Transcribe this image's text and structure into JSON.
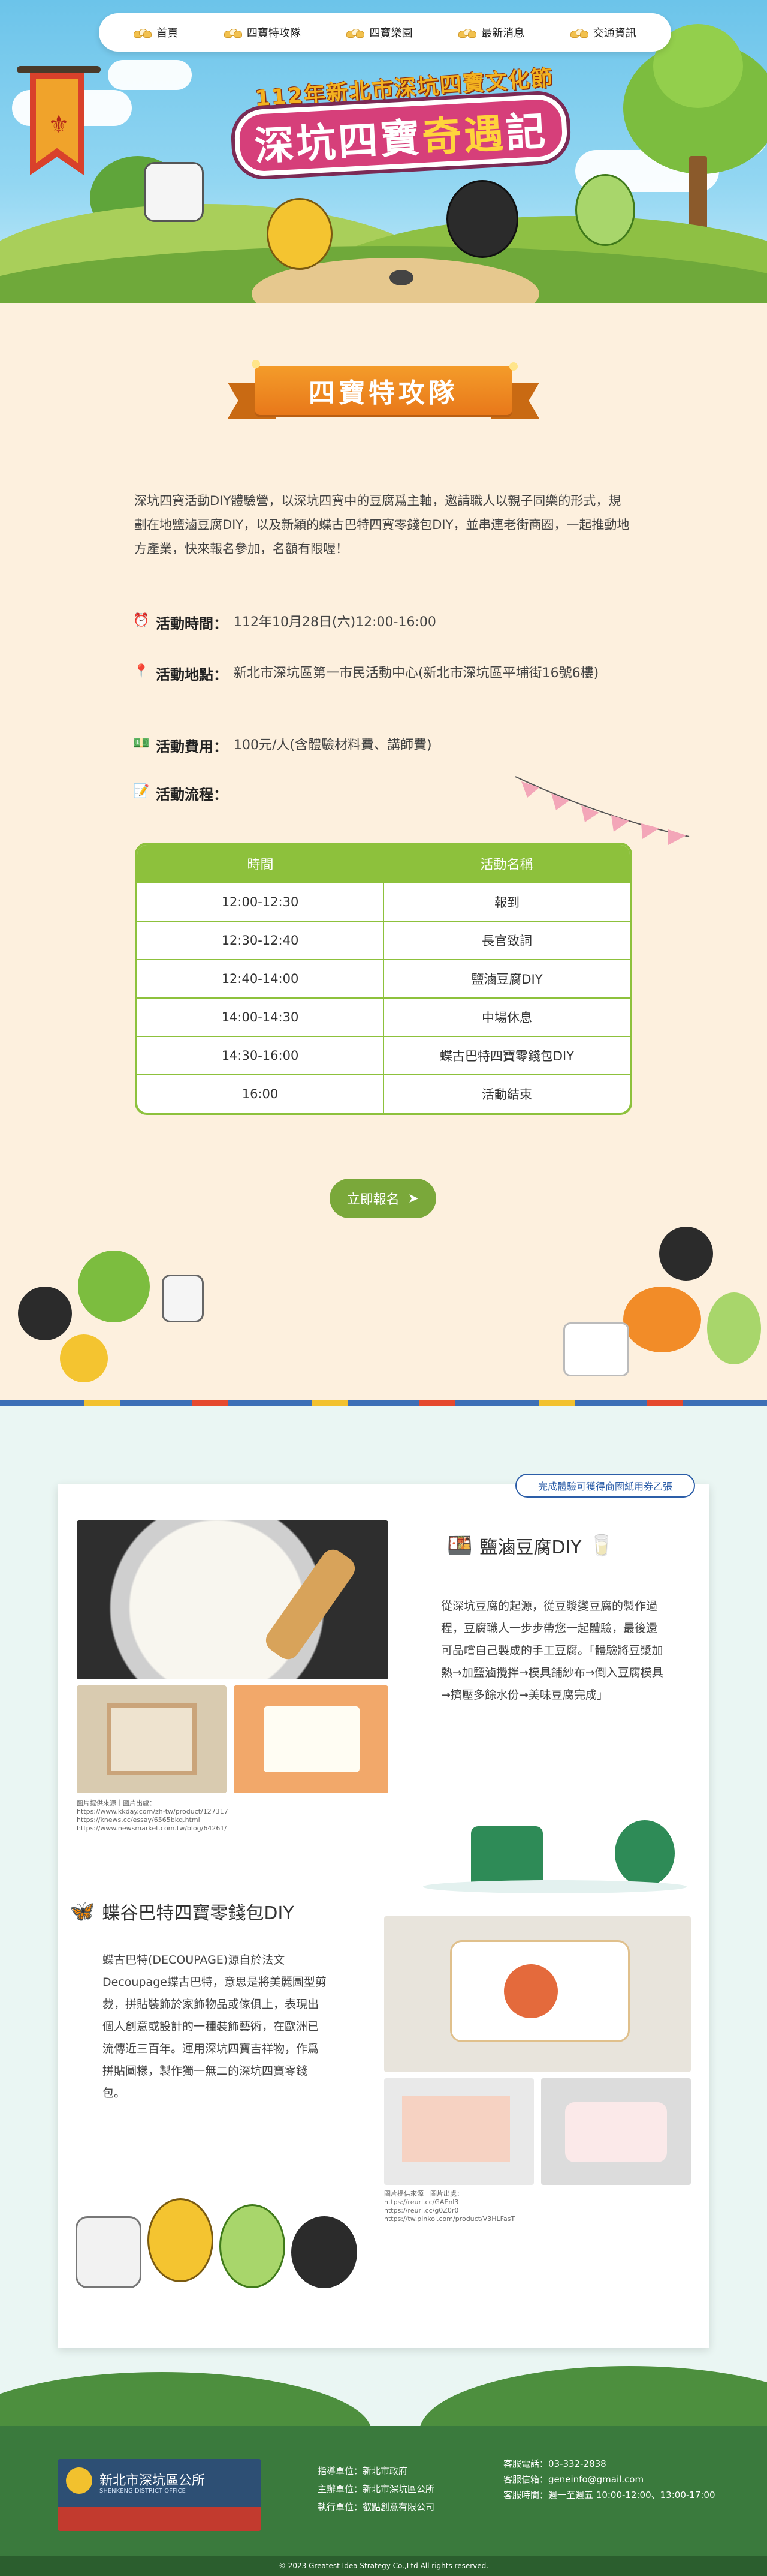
{
  "nav": {
    "items": [
      {
        "label": "首頁"
      },
      {
        "label": "四寶特攻隊"
      },
      {
        "label": "四寶樂園"
      },
      {
        "label": "最新消息"
      },
      {
        "label": "交通資訊"
      }
    ]
  },
  "hero": {
    "subtitle": "112年新北市深坑四寶文化節",
    "title_a": "深坑四寶",
    "title_b": "奇遇",
    "title_c": "記"
  },
  "section1": {
    "ribbon": "四寶特攻隊",
    "intro": "深坑四寶活動DIY體驗營，以深坑四寶中的豆腐爲主軸，邀請職人以親子同樂的形式，規劃在地鹽滷豆腐DIY，以及新穎的蝶古巴特四寶零錢包DIY，並串連老街商圈，一起推動地方產業，快來報名參加，名額有限喔！",
    "time_label": "活動時間：",
    "time_value": "112年10月28日(六)12:00-16:00",
    "place_label": "活動地點：",
    "place_value": "新北市深坑區第一市民活動中心(新北市深坑區平埔街16號6樓)",
    "fee_label": "活動費用：",
    "fee_value": "100元/人(含體驗材料費、講師費)",
    "flow_label": "活動流程："
  },
  "schedule": {
    "headers": [
      "時間",
      "活動名稱"
    ],
    "rows": [
      [
        "12:00-12:30",
        "報到"
      ],
      [
        "12:30-12:40",
        "長官致詞"
      ],
      [
        "12:40-14:00",
        "鹽滷豆腐DIY"
      ],
      [
        "14:00-14:30",
        "中場休息"
      ],
      [
        "14:30-16:00",
        "蝶古巴特四寶零錢包DIY"
      ],
      [
        "16:00",
        "活動結束"
      ]
    ]
  },
  "signup": {
    "label": "立即報名"
  },
  "section2": {
    "tag": "完成體驗可獲得商圈紙用券乙張",
    "tofu_title": "鹽滷豆腐DIY",
    "tofu_text": "從深坑豆腐的起源，從豆漿變豆腐的製作過程，豆腐職人一步步帶您一起體驗，最後還可品嚐自己製成的手工豆腐。「體驗將豆漿加熱→加鹽滷攪拌→模具鋪紗布→倒入豆腐模具→擠壓多餘水份→美味豆腐完成」",
    "tofu_credit": [
      "圖片提供來源｜圖片出處：",
      "https://www.kkday.com/zh-tw/product/127317",
      "https://knews.cc/essay/6565bkq.html",
      "https://www.newsmarket.com.tw/blog/64261/"
    ],
    "decoupage_title": "蝶谷巴特四寶零錢包DIY",
    "decoupage_text": "蝶古巴特(DECOUPAGE)源自於法文Decoupage蝶古巴特，意思是將美麗圖型剪裁，拼貼裝飾於家飾物品或傢俱上，表現出個人創意或設計的一種裝飾藝術，在歐洲已流傳近三百年。運用深坑四寶吉祥物，作爲拼貼圖樣，製作獨一無二的深坑四寶零錢包。",
    "decoupage_credit": [
      "圖片提供來源｜圖片出處：",
      "https://reurl.cc/GAEnl3",
      "https://reurl.cc/g0Z0r0",
      "https://tw.pinkoi.com/product/V3HLFasT"
    ]
  },
  "footer": {
    "logo_text": "新北市深坑區公所",
    "logo_sub": "SHENKENG DISTRICT OFFICE",
    "guide_label": "指導單位：",
    "guide_value": "新北市政府",
    "host_label": "主辦單位：",
    "host_value": "新北市深坑區公所",
    "exec_label": "執行單位：",
    "exec_value": "叡點創意有限公司",
    "phone": "客服電話：03-332-2838",
    "email": "客服信箱：geneinfo@gmail.com",
    "hours": "客服時間：週一至週五 10:00-12:00、13:00-17:00",
    "copyright": "© 2023 Greatest Idea Strategy Co.,Ltd All rights reserved."
  },
  "colors": {
    "accent_green": "#8dc13c",
    "ribbon_orange": "#f49c2a",
    "title_pink": "#d63f7a",
    "footer_green": "#3a7a3d"
  }
}
